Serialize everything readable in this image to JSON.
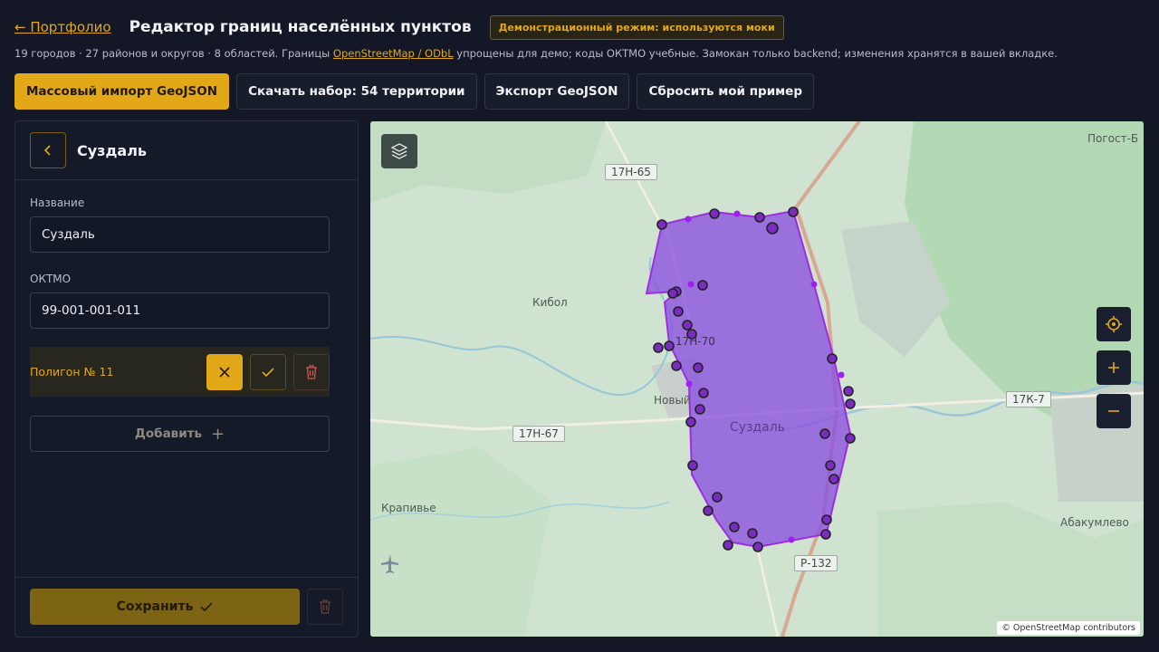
{
  "header": {
    "back_link": "← Портфолио",
    "title": "Редактор границ населённых пунктов",
    "demo_badge": "Демонстрационный режим: используются моки"
  },
  "subline": {
    "before": "19 городов · 27 районов и округов · 8 областей. Границы ",
    "link": "OpenStreetMap / ODbL",
    "after": " упрощены для демо; коды ОКТМО учебные. Замокан только backend; изменения хранятся в вашей вкладке."
  },
  "toolbar": {
    "import_label": "Массовый импорт GeoJSON",
    "download_label": "Скачать набор: 54 территории",
    "export_label": "Экспорт GeoJSON",
    "reset_label": "Сбросить мой пример"
  },
  "panel": {
    "title": "Суздаль",
    "name_label": "Название",
    "name_value": "Суздаль",
    "oktmo_label": "ОКТМО",
    "oktmo_value": "99-001-001-011",
    "polygon_label": "Полигон № 11",
    "add_label": "Добавить",
    "save_label": "Сохранить"
  },
  "map": {
    "city_label": "Суздаль",
    "places": [
      "Погост-Б",
      "Кибол",
      "Новый",
      "Крапивье",
      "Абакумлево"
    ],
    "roads": [
      "17Н-65",
      "17Н-67",
      "17К-7",
      "Р-132",
      "17Н-70"
    ],
    "attribution": "© OpenStreetMap contributors",
    "polygon_color": "#8a2be2"
  },
  "icons": {
    "back": "chevron-left-icon",
    "layers": "layers-icon",
    "locate": "crosshair-icon",
    "zoom_in": "plus-icon",
    "zoom_out": "minus-icon",
    "cancel": "close-icon",
    "confirm": "check-icon",
    "delete": "trash-icon"
  }
}
